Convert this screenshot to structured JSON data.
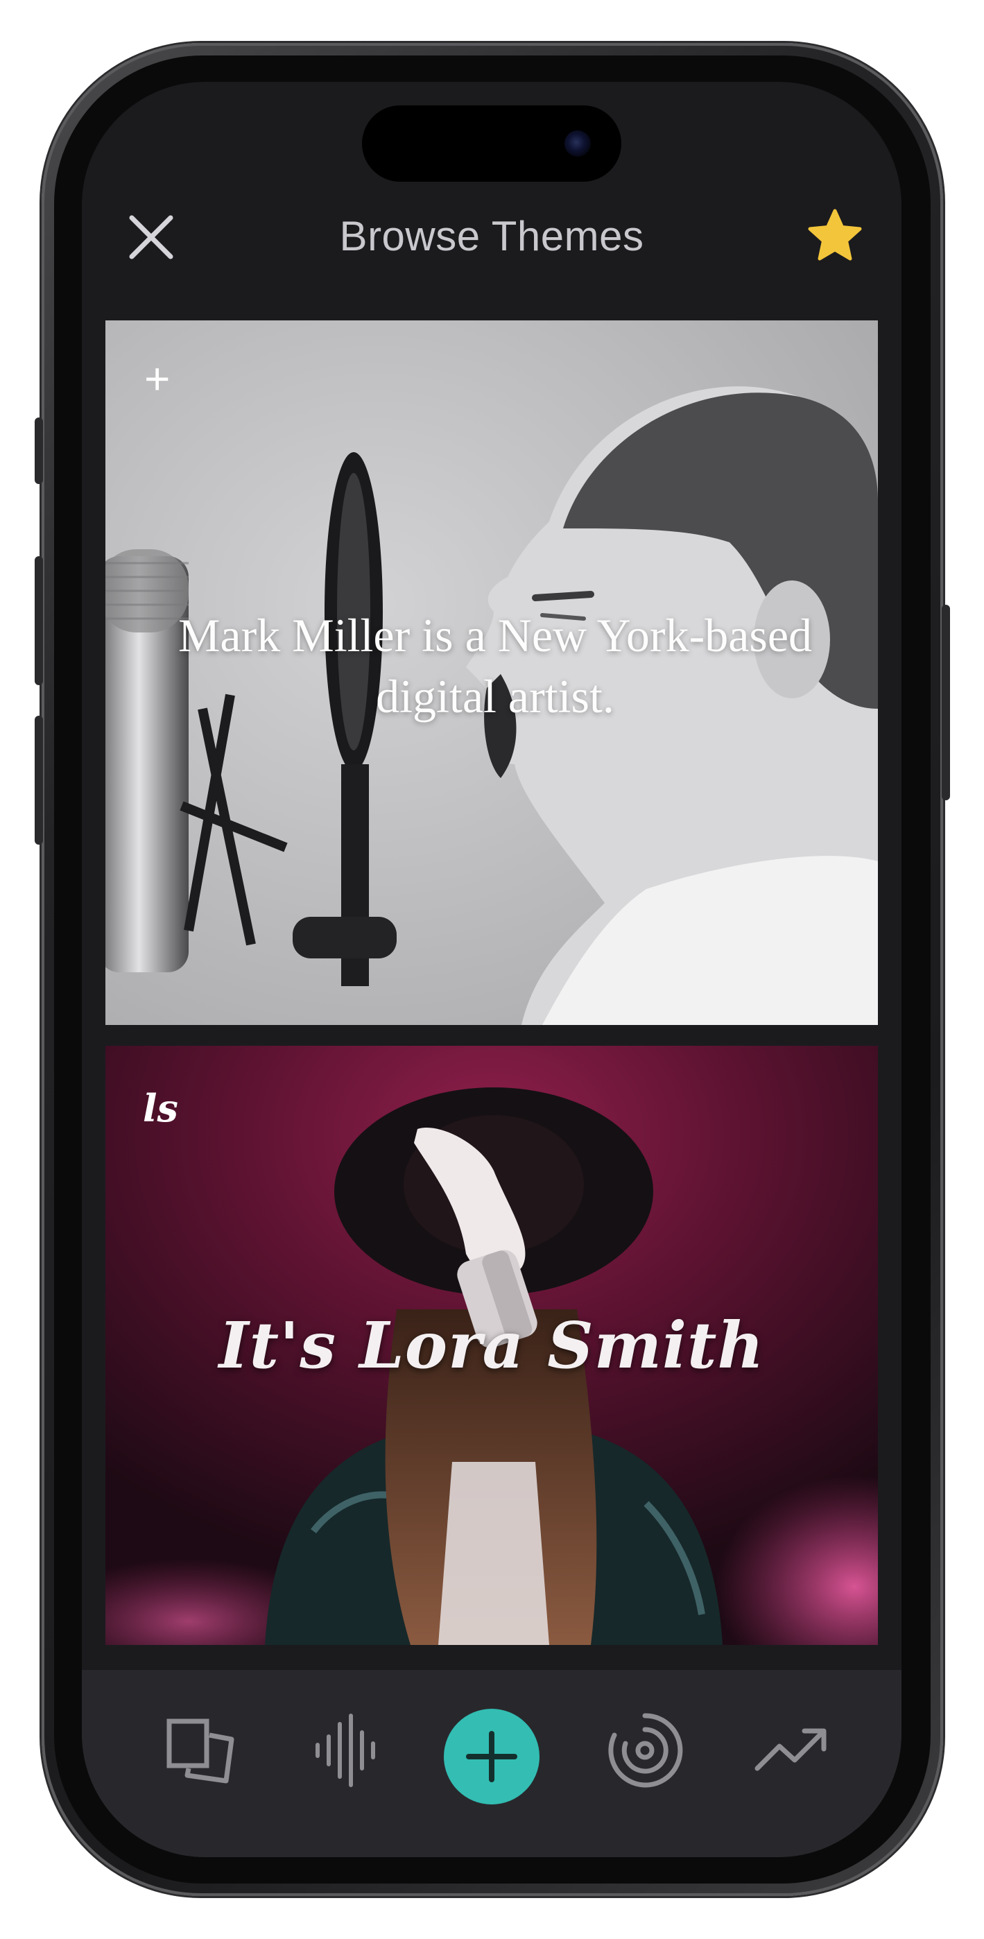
{
  "header": {
    "title": "Browse Themes",
    "star_color": "#f3c53a"
  },
  "themes": [
    {
      "badge": "+",
      "headline": "Mark Miller is a New York-based digital artist."
    },
    {
      "badge": "ls",
      "headline": "It's Lora Smith"
    }
  ],
  "tabbar": {
    "items": [
      "pages-icon",
      "audio-waveform-icon",
      "add-icon",
      "radar-icon",
      "trending-icon"
    ],
    "accent": "#33bdb3"
  }
}
